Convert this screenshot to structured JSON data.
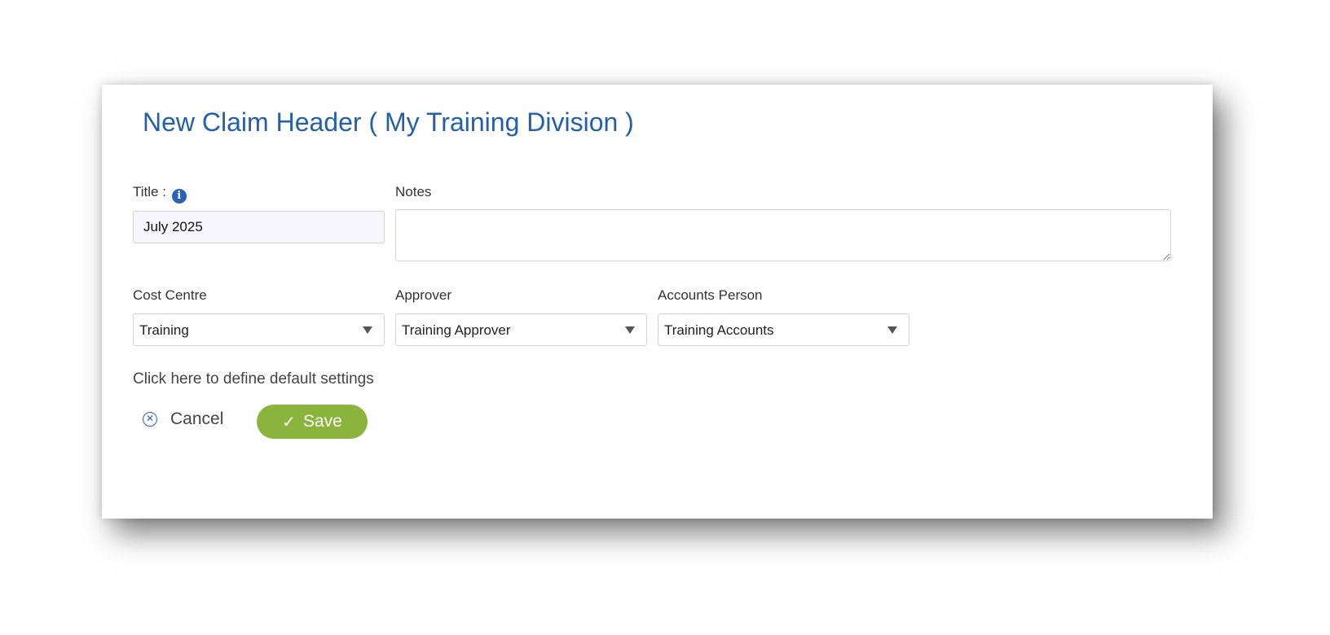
{
  "dialog": {
    "title": "New Claim Header ( My Training Division )"
  },
  "form": {
    "title_label": "Title :",
    "title_value": "July 2025",
    "notes_label": "Notes",
    "notes_value": "",
    "cost_centre_label": "Cost Centre",
    "cost_centre_value": "Training",
    "approver_label": "Approver",
    "approver_value": "Training Approver",
    "accounts_person_label": "Accounts Person",
    "accounts_person_value": "Training Accounts"
  },
  "actions": {
    "default_settings_link": "Click here to define default settings",
    "cancel_label": "Cancel",
    "save_label": "Save"
  },
  "icons": {
    "info": "info-icon",
    "dropdown": "triangle-down-icon",
    "cancel": "circle-x-icon",
    "save": "checkmark-icon"
  },
  "colors": {
    "title": "#2460a7",
    "save_button": "#8ab43c",
    "info_icon": "#2a62b4"
  }
}
